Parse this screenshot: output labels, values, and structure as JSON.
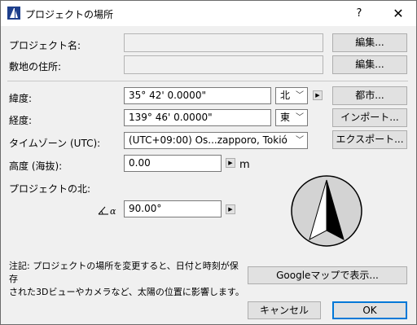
{
  "window": {
    "title": "プロジェクトの場所",
    "help_label": "?",
    "close_label": "✕",
    "icon": "archicad-app-icon"
  },
  "project_name": {
    "label": "プロジェクト名:",
    "value": "",
    "edit_button": "編集..."
  },
  "site_address": {
    "label": "敷地の住所:",
    "value": "",
    "edit_button": "編集..."
  },
  "latitude": {
    "label": "緯度:",
    "value": "35° 42' 0.0000\"",
    "hemisphere": "北"
  },
  "longitude": {
    "label": "経度:",
    "value": "139° 46' 0.0000\"",
    "hemisphere": "東"
  },
  "timezone": {
    "label": "タイムゾーン (UTC):",
    "value": "(UTC+09:00) Os...zapporo, Tokió"
  },
  "altitude": {
    "label": "高度 (海抜):",
    "value": "0.00",
    "unit": "m"
  },
  "project_north": {
    "label": "プロジェクトの北:",
    "value": "90.00°",
    "angle_icon_label": "α"
  },
  "buttons": {
    "city": "都市...",
    "import": "インポート...",
    "export": "エクスポート...",
    "google_maps": "Googleマップで表示...",
    "cancel": "キャンセル",
    "ok": "OK"
  },
  "note": {
    "line1": "注記: プロジェクトの場所を変更すると、日付と時刻が保存",
    "line2": "された3Dビューやカメラなど、太陽の位置に影響します。"
  },
  "compass_north_direction_deg": 90
}
